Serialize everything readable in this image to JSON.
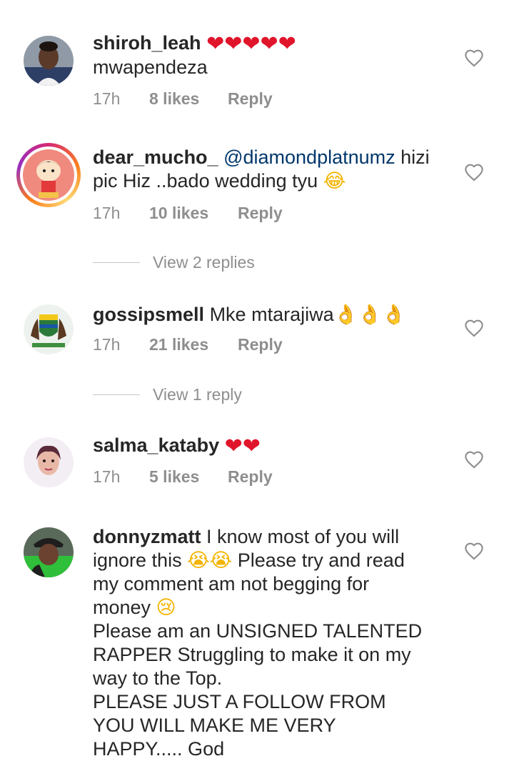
{
  "comments": [
    {
      "username": "shiroh_leah",
      "text_emojis": "❤❤❤❤❤",
      "text": "mwapendeza",
      "time": "17h",
      "likes": "8 likes",
      "reply": "Reply"
    },
    {
      "username": "dear_mucho_",
      "mention": "@diamondplatnumz",
      "text": " hizi pic Hiz ..bado wedding tyu ",
      "text_emoji": "😂",
      "time": "17h",
      "likes": "10 likes",
      "reply": "Reply",
      "view_replies": "View 2 replies"
    },
    {
      "username": "gossipsmell",
      "text": " Mke mtarajiwa",
      "text_emojis": "👌👌👌",
      "time": "17h",
      "likes": "21 likes",
      "reply": "Reply",
      "view_replies": "View 1 reply"
    },
    {
      "username": "salma_kataby",
      "text_emojis": "❤❤",
      "time": "17h",
      "likes": "5 likes",
      "reply": "Reply"
    },
    {
      "username": "donnyzmatt",
      "text_part1": " I know most of you will ignore this ",
      "cry_emojis": "😭😭",
      "text_part2": " Please try and read my comment am not begging for money ",
      "sad_emoji": "😢",
      "text_part3": "Please am an UNSIGNED TALENTED RAPPER Struggling to make it on my way to the Top.",
      "text_part4": "PLEASE JUST A FOLLOW FROM YOU WILL MAKE ME VERY HAPPY..... God"
    }
  ],
  "colors": {
    "text": "#262626",
    "secondary": "#8e8e8e",
    "mention": "#00376b",
    "heart": "#e0142b"
  },
  "icons": {
    "like": "heart-outline-icon"
  }
}
